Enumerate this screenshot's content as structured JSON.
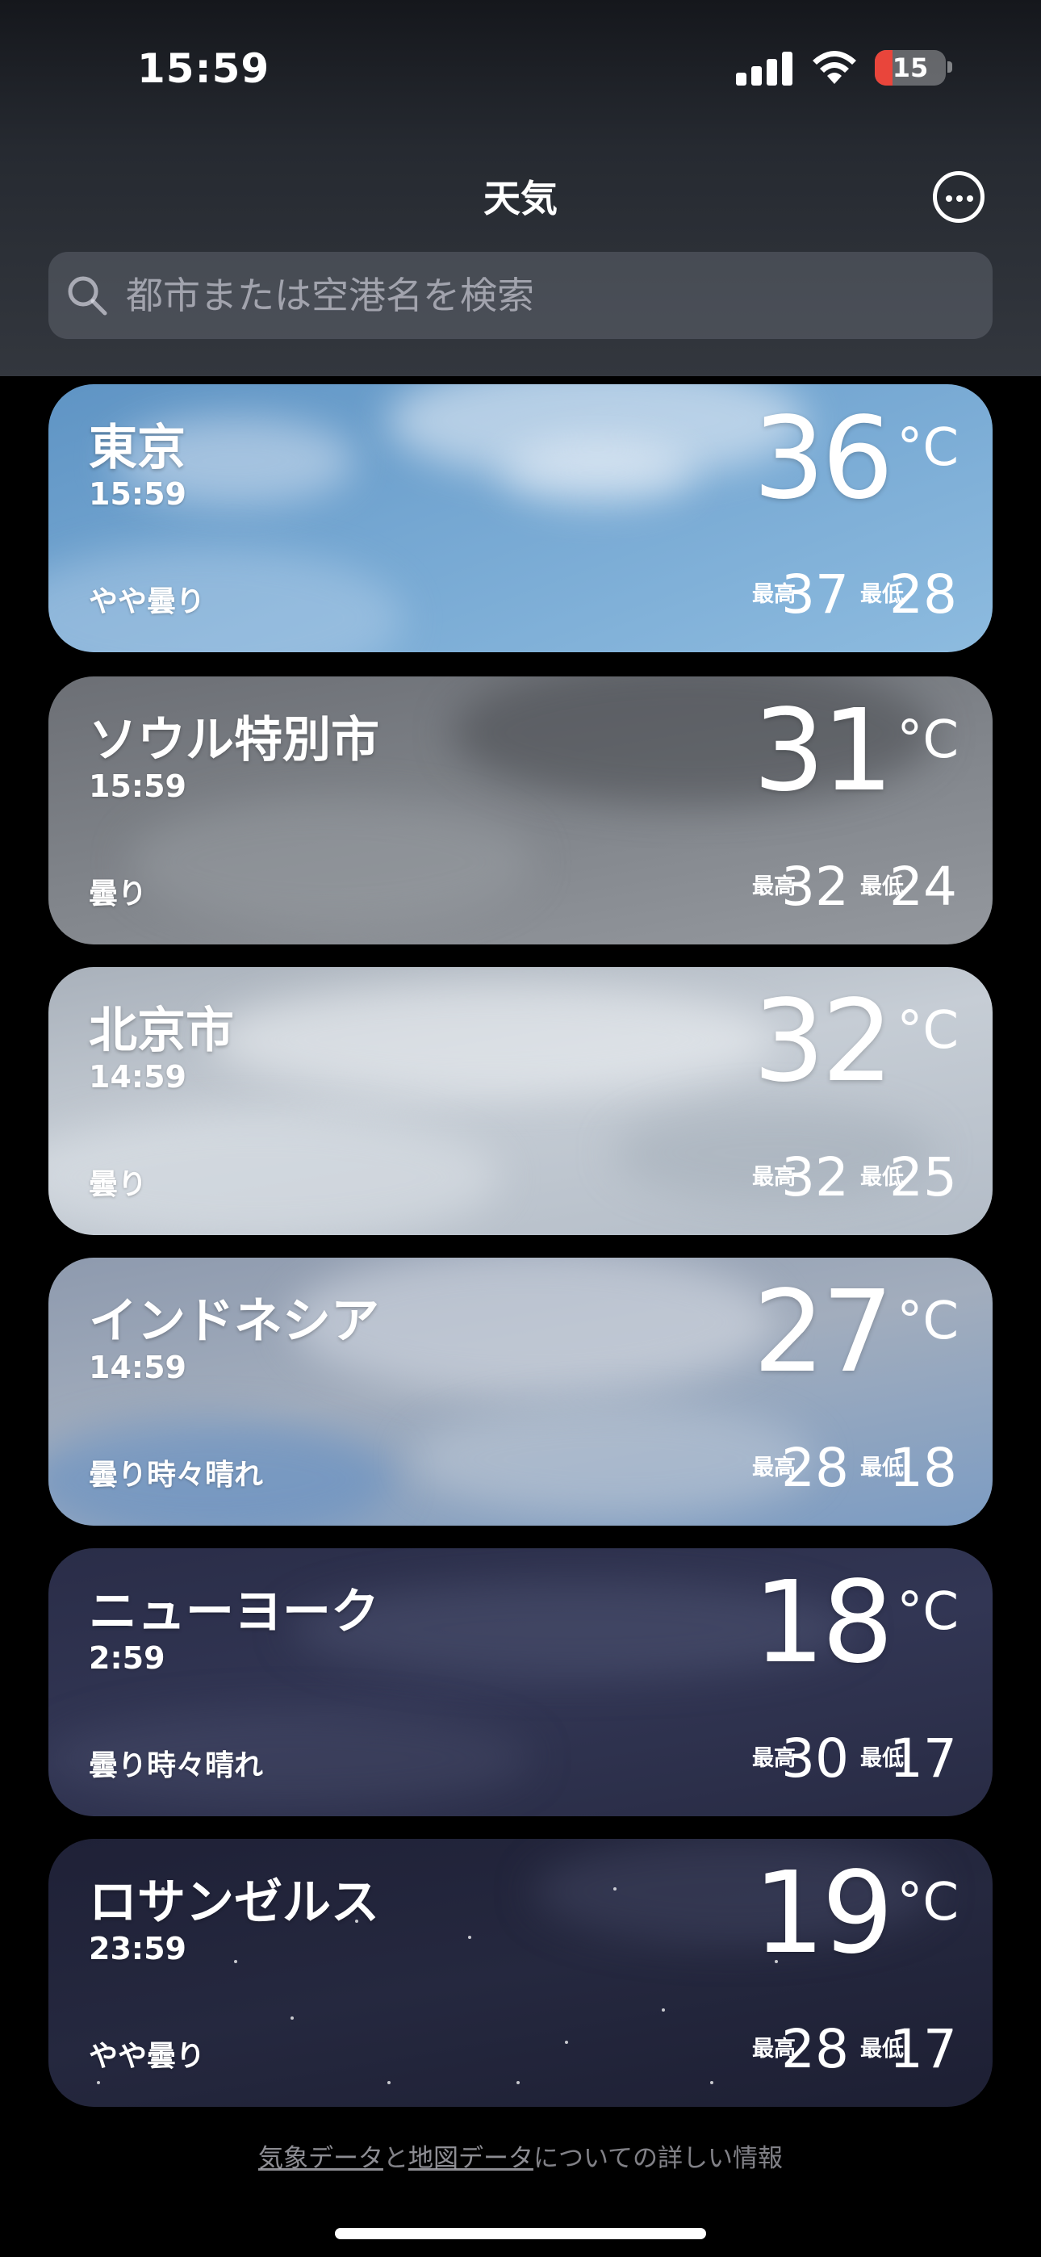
{
  "status_bar": {
    "time": "15:59",
    "battery": "15"
  },
  "header": {
    "title": "天気"
  },
  "search": {
    "placeholder": "都市または空港名を検索"
  },
  "labels": {
    "high": "最高",
    "low": "最低",
    "unit": "°C"
  },
  "cities": [
    {
      "name": "東京",
      "time": "15:59",
      "condition": "やや曇り",
      "temp": "36",
      "high": "37",
      "low": "28"
    },
    {
      "name": "ソウル特別市",
      "time": "15:59",
      "condition": "曇り",
      "temp": "31",
      "high": "32",
      "low": "24"
    },
    {
      "name": "北京市",
      "time": "14:59",
      "condition": "曇り",
      "temp": "32",
      "high": "32",
      "low": "25"
    },
    {
      "name": "インドネシア",
      "time": "14:59",
      "condition": "曇り時々晴れ",
      "temp": "27",
      "high": "28",
      "low": "18"
    },
    {
      "name": "ニューヨーク",
      "time": "2:59",
      "condition": "曇り時々晴れ",
      "temp": "18",
      "high": "30",
      "low": "17"
    },
    {
      "name": "ロサンゼルス",
      "time": "23:59",
      "condition": "やや曇り",
      "temp": "19",
      "high": "28",
      "low": "17"
    }
  ],
  "footer": {
    "link_weather": "気象データ",
    "and": "と",
    "link_map": "地図データ",
    "suffix": "についての詳しい情報"
  }
}
